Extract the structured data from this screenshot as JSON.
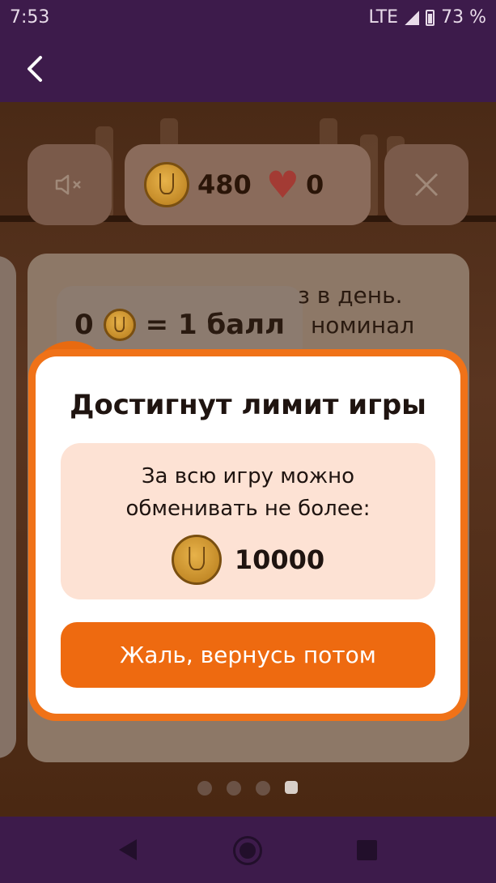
{
  "status_bar": {
    "time": "7:53",
    "network": "LTE",
    "battery": "73 %"
  },
  "game": {
    "coins": "480",
    "lives": "0",
    "card_text_1": "з в день.",
    "card_text_2": "номинал",
    "rate_left": "0",
    "rate_right": "= 1 балл",
    "pages": 4,
    "active_page": 4
  },
  "modal": {
    "title": "Достигнут лимит игры",
    "line1": "За всю игру можно",
    "line2": "обменивать не более:",
    "limit": "10000",
    "button": "Жаль, вернусь потом"
  },
  "colors": {
    "accent": "#ee6a10",
    "header": "#3d1b4b",
    "info_bg": "#fde2d4"
  }
}
